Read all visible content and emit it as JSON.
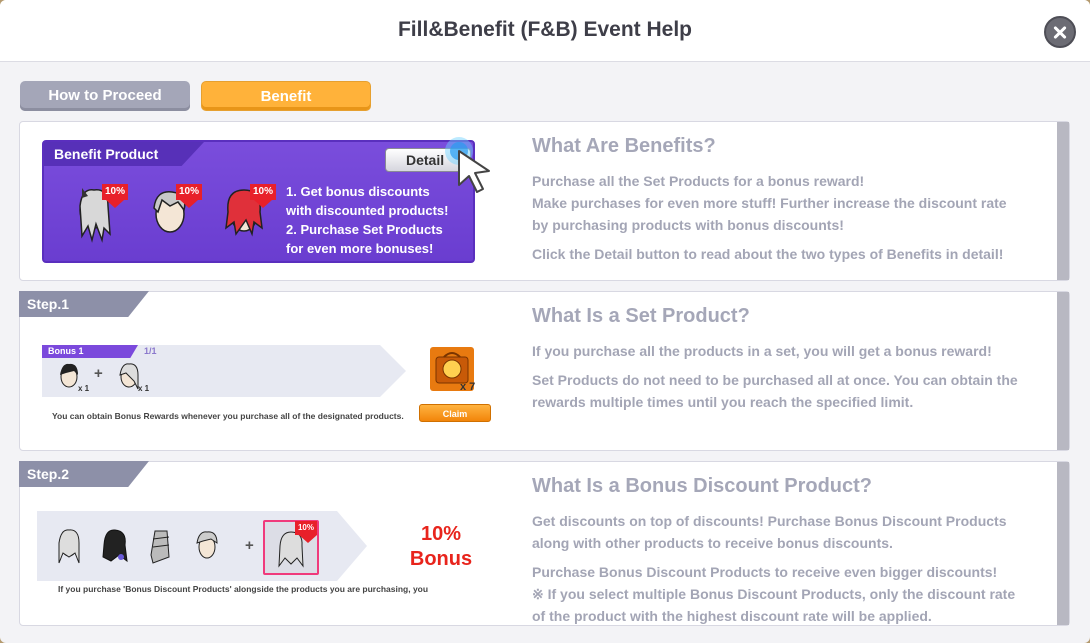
{
  "header": {
    "title": "Fill&Benefit (F&B) Event Help"
  },
  "tabs": [
    {
      "label": "How to Proceed",
      "active": false
    },
    {
      "label": "Benefit",
      "active": true
    }
  ],
  "benefit_section": {
    "card_label": "Benefit Product",
    "detail_button": "Detail",
    "items": [
      {
        "icon": "hair-item-icon",
        "badge": "10%"
      },
      {
        "icon": "hair-item-icon",
        "badge": "10%"
      },
      {
        "icon": "hair-item-icon",
        "badge": "10%"
      }
    ],
    "list": [
      "1. Get bonus discounts",
      "with discounted products!",
      "2. Purchase Set Products",
      "for even more bonuses!"
    ],
    "heading": "What Are Benefits?",
    "paragraphs": [
      "Purchase all the Set Products for a bonus reward!",
      "Make purchases for even more stuff! Further increase the discount rate",
      "by purchasing products with bonus discounts!",
      "Click the Detail button to read about the two types of Benefits in detail!"
    ]
  },
  "step1": {
    "tag": "Step.1",
    "bonus_label": "Bonus 1",
    "bonus_count": "1/1",
    "item_qty_1": "x 1",
    "item_qty_2": "x 1",
    "reward_qty": "x 7",
    "note": "You can obtain Bonus Rewards whenever you purchase all of the designated products.",
    "claim_button": "Claim",
    "heading": "What Is a Set Product?",
    "paragraphs": [
      "If you purchase all the products in a set, you will get a bonus reward!",
      "Set Products do not need to be purchased all at once. You can obtain the",
      "rewards multiple times until you reach the specified limit."
    ]
  },
  "step2": {
    "tag": "Step.2",
    "highlight_badge": "10%",
    "bonus_percent": "10%",
    "bonus_word": "Bonus",
    "note": "If you purchase 'Bonus Discount Products' alongside the products you are purchasing, you",
    "heading": "What Is a Bonus Discount Product?",
    "paragraphs": [
      "Get discounts on top of discounts! Purchase Bonus Discount Products",
      "along with other products to receive bonus discounts.",
      "Purchase Bonus Discount Products to receive even bigger discounts!",
      "※ If you select multiple Bonus Discount Products, only the discount rate",
      "of the product with the highest discount rate will be applied."
    ]
  },
  "colors": {
    "accent_orange": "#ffb23a",
    "benefit_purple": "#6a3dd0",
    "bonus_red": "#e8241c"
  }
}
